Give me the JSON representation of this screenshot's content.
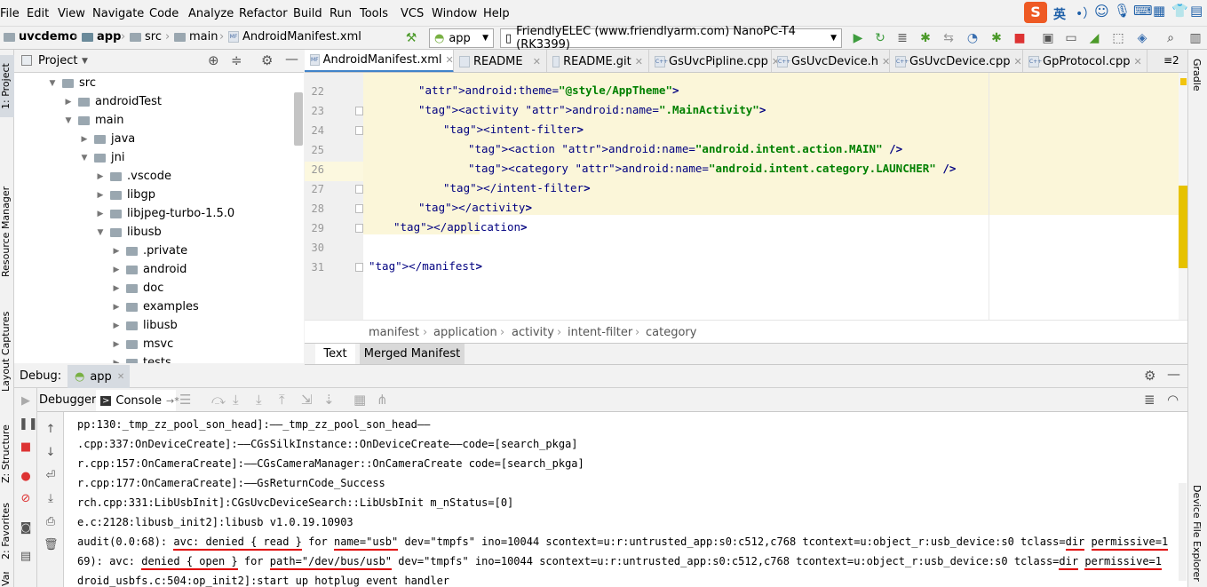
{
  "menu": [
    "File",
    "Edit",
    "View",
    "Navigate",
    "Code",
    "Analyze",
    "Refactor",
    "Build",
    "Run",
    "Tools",
    "VCS",
    "Window",
    "Help"
  ],
  "ime": {
    "lang_label": "英"
  },
  "breadcrumb": {
    "project": "uvcdemo",
    "module": "app",
    "src": "src",
    "main": "main",
    "file": "AndroidManifest.xml"
  },
  "run_config": "app",
  "device": "FriendlyELEC (www.friendlyarm.com) NanoPC-T4 (RK3399)",
  "left_tools": {
    "project": "1: Project",
    "resource": "Resource Manager",
    "layout": "Layout Captures",
    "structure": "Z: Structure",
    "favorites": "2: Favorites",
    "variants": "Variants"
  },
  "right_tools": {
    "gradle": "Gradle",
    "explorer": "Device File Explorer"
  },
  "project_panel": {
    "title": "Project"
  },
  "tree": [
    {
      "label": "src",
      "depth": 0,
      "open": true
    },
    {
      "label": "androidTest",
      "depth": 1,
      "open": false
    },
    {
      "label": "main",
      "depth": 1,
      "open": true
    },
    {
      "label": "java",
      "depth": 2,
      "open": false
    },
    {
      "label": "jni",
      "depth": 2,
      "open": true
    },
    {
      "label": ".vscode",
      "depth": 3,
      "open": false
    },
    {
      "label": "libgp",
      "depth": 3,
      "open": false
    },
    {
      "label": "libjpeg-turbo-1.5.0",
      "depth": 3,
      "open": false
    },
    {
      "label": "libusb",
      "depth": 3,
      "open": true
    },
    {
      "label": ".private",
      "depth": 4,
      "open": false
    },
    {
      "label": "android",
      "depth": 4,
      "open": false
    },
    {
      "label": "doc",
      "depth": 4,
      "open": false
    },
    {
      "label": "examples",
      "depth": 4,
      "open": false
    },
    {
      "label": "libusb",
      "depth": 4,
      "open": false
    },
    {
      "label": "msvc",
      "depth": 4,
      "open": false
    },
    {
      "label": "tests",
      "depth": 4,
      "open": false
    }
  ],
  "editor_tabs": [
    {
      "label": "AndroidManifest.xml",
      "icon": "MF",
      "active": true
    },
    {
      "label": "README",
      "icon": "",
      "active": false
    },
    {
      "label": "README.git",
      "icon": "",
      "active": false
    },
    {
      "label": "GsUvcPipline.cpp",
      "icon": "C++",
      "active": false
    },
    {
      "label": "GsUvcDevice.h",
      "icon": "C++",
      "active": false
    },
    {
      "label": "GsUvcDevice.cpp",
      "icon": "C++",
      "active": false
    },
    {
      "label": "GpProtocol.cpp",
      "icon": "C++",
      "active": false
    }
  ],
  "tabs_overflow": "≡2",
  "code_lines": [
    {
      "n": "22",
      "text": "android:theme=\"@style/AppTheme\">"
    },
    {
      "n": "23",
      "text": "<activity android:name=\".MainActivity\">"
    },
    {
      "n": "24",
      "text": "<intent-filter>"
    },
    {
      "n": "25",
      "text": "<action android:name=\"android.intent.action.MAIN\" />"
    },
    {
      "n": "26",
      "text": "<category android:name=\"android.intent.category.LAUNCHER\" />"
    },
    {
      "n": "27",
      "text": "</intent-filter>"
    },
    {
      "n": "28",
      "text": "</activity>"
    },
    {
      "n": "29",
      "text": "</application>"
    },
    {
      "n": "30",
      "text": ""
    },
    {
      "n": "31",
      "text": "</manifest>"
    }
  ],
  "xml_breadcrumb": [
    "manifest",
    "application",
    "activity",
    "intent-filter",
    "category"
  ],
  "editor_subtabs": {
    "text": "Text",
    "merged": "Merged Manifest"
  },
  "debug": {
    "title": "Debug:",
    "config": "app",
    "debugger_tab": "Debugger",
    "console_tab": "Console"
  },
  "console_lines": [
    "pp:130:_tmp_zz_pool_son_head]:——_tmp_zz_pool_son_head——",
    ".cpp:337:OnDeviceCreate]:——CGsSilkInstance::OnDeviceCreate——code=[search_pkga]",
    "r.cpp:157:OnCameraCreate]:——CGsCameraManager::OnCameraCreate code=[search_pkga]",
    "r.cpp:177:OnCameraCreate]:——GsReturnCode_Success",
    "rch.cpp:331:LibUsbInit]:CGsUvcDeviceSearch::LibUsbInit m_nStatus=[0]",
    "e.c:2128:libusb_init2]:libusb v1.0.19.10903",
    "audit(0.0:68): avc: denied { read } for name=\"usb\" dev=\"tmpfs\" ino=10044 scontext=u:r:untrusted_app:s0:c512,c768 tcontext=u:object_r:usb_device:s0 tclass=dir permissive=1",
    "69): avc: denied { open } for path=\"/dev/bus/usb\" dev=\"tmpfs\" ino=10044 scontext=u:r:untrusted_app:s0:c512,c768 tcontext=u:object_r:usb_device:s0 tclass=dir permissive=1",
    "droid_usbfs.c:504:op_init2]:start up hotplug event handler"
  ],
  "colors": {
    "accent": "#4083c9",
    "highlight": "#fbf6d9",
    "annotation": "#e00000"
  }
}
